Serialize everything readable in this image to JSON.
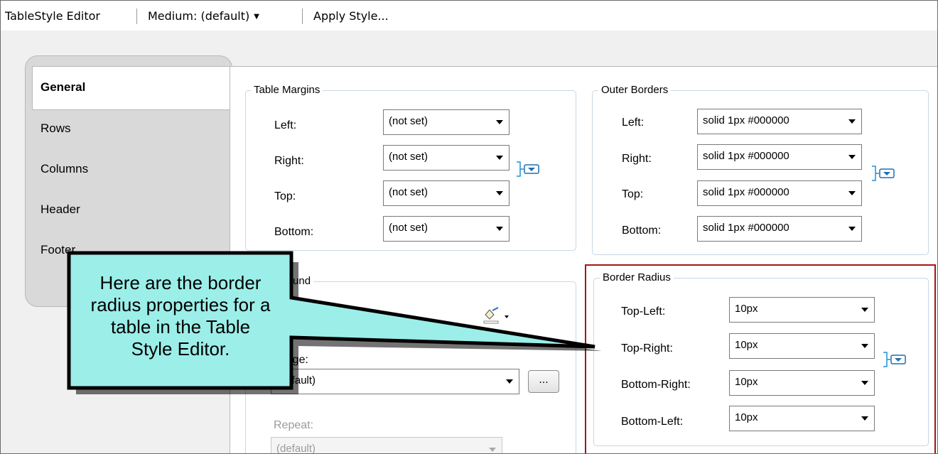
{
  "toolbar": {
    "title": "TableStyle Editor",
    "style_selector": "Medium: (default)",
    "apply_label": "Apply Style..."
  },
  "tabs": [
    {
      "label": "General"
    },
    {
      "label": "Rows"
    },
    {
      "label": "Columns"
    },
    {
      "label": "Header"
    },
    {
      "label": "Footer"
    }
  ],
  "table_margins": {
    "legend": "Table Margins",
    "rows": [
      {
        "label": "Left:",
        "value": "(not set)"
      },
      {
        "label": "Right:",
        "value": "(not set)"
      },
      {
        "label": "Top:",
        "value": "(not set)"
      },
      {
        "label": "Bottom:",
        "value": "(not set)"
      }
    ]
  },
  "outer_borders": {
    "legend": "Outer Borders",
    "rows": [
      {
        "label": "Left:",
        "value": "solid 1px #000000"
      },
      {
        "label": "Right:",
        "value": "solid 1px #000000"
      },
      {
        "label": "Top:",
        "value": "solid 1px #000000"
      },
      {
        "label": "Bottom:",
        "value": "solid 1px #000000"
      }
    ]
  },
  "background": {
    "legend": "Background",
    "image_label": "Image:",
    "image_value": "(default)",
    "browse_label": "...",
    "repeat_label": "Repeat:",
    "repeat_value": "(default)"
  },
  "border_radius": {
    "legend": "Border Radius",
    "rows": [
      {
        "label": "Top-Left:",
        "value": "10px"
      },
      {
        "label": "Top-Right:",
        "value": "10px"
      },
      {
        "label": "Bottom-Right:",
        "value": "10px"
      },
      {
        "label": "Bottom-Left:",
        "value": "10px"
      }
    ]
  },
  "callout": {
    "lines": [
      "Here are the border",
      "radius properties for a",
      "table in the Table",
      "Style Editor."
    ]
  },
  "colors": {
    "highlight_border": "#a31616",
    "callout_fill": "#9ceee9",
    "group_border": "#c9d7e3",
    "link_icon": "#1e90d6"
  },
  "icons": {
    "link_toggle": "link-bracket-icon",
    "color_picker": "fill-color-icon"
  }
}
